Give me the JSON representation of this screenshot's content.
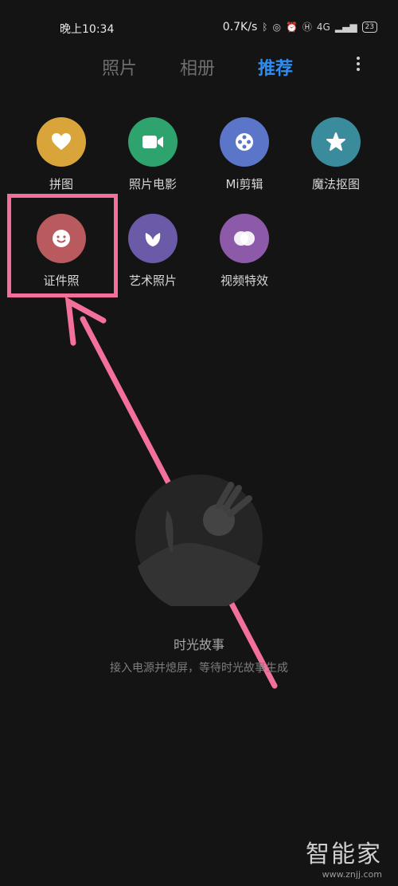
{
  "status_bar": {
    "time": "晚上10:34",
    "speed": "0.7K/s",
    "network": "4G",
    "battery": "23"
  },
  "tabs": [
    {
      "label": "照片",
      "active": false
    },
    {
      "label": "相册",
      "active": false
    },
    {
      "label": "推荐",
      "active": true
    }
  ],
  "tools": [
    {
      "label": "拼图",
      "color": "#d9a53a",
      "icon": "heart-icon"
    },
    {
      "label": "照片电影",
      "color": "#2fa36e",
      "icon": "video-camera-icon"
    },
    {
      "label": "Mi剪辑",
      "color": "#5b76c8",
      "icon": "film-reel-icon"
    },
    {
      "label": "魔法抠图",
      "color": "#3a8c9c",
      "icon": "star-icon"
    },
    {
      "label": "证件照",
      "color": "#b85a5e",
      "icon": "smiley-icon"
    },
    {
      "label": "艺术照片",
      "color": "#6a5aa8",
      "icon": "leaf-icon"
    },
    {
      "label": "视频特效",
      "color": "#8c5aa8",
      "icon": "overlap-circles-icon"
    }
  ],
  "highlight_color": "#f3709a",
  "accent_color": "#2f8cf0",
  "story": {
    "title": "时光故事",
    "description": "接入电源并熄屏，等待时光故事生成"
  },
  "watermark": {
    "brand": "智能家",
    "url": "www.znjj.com"
  }
}
